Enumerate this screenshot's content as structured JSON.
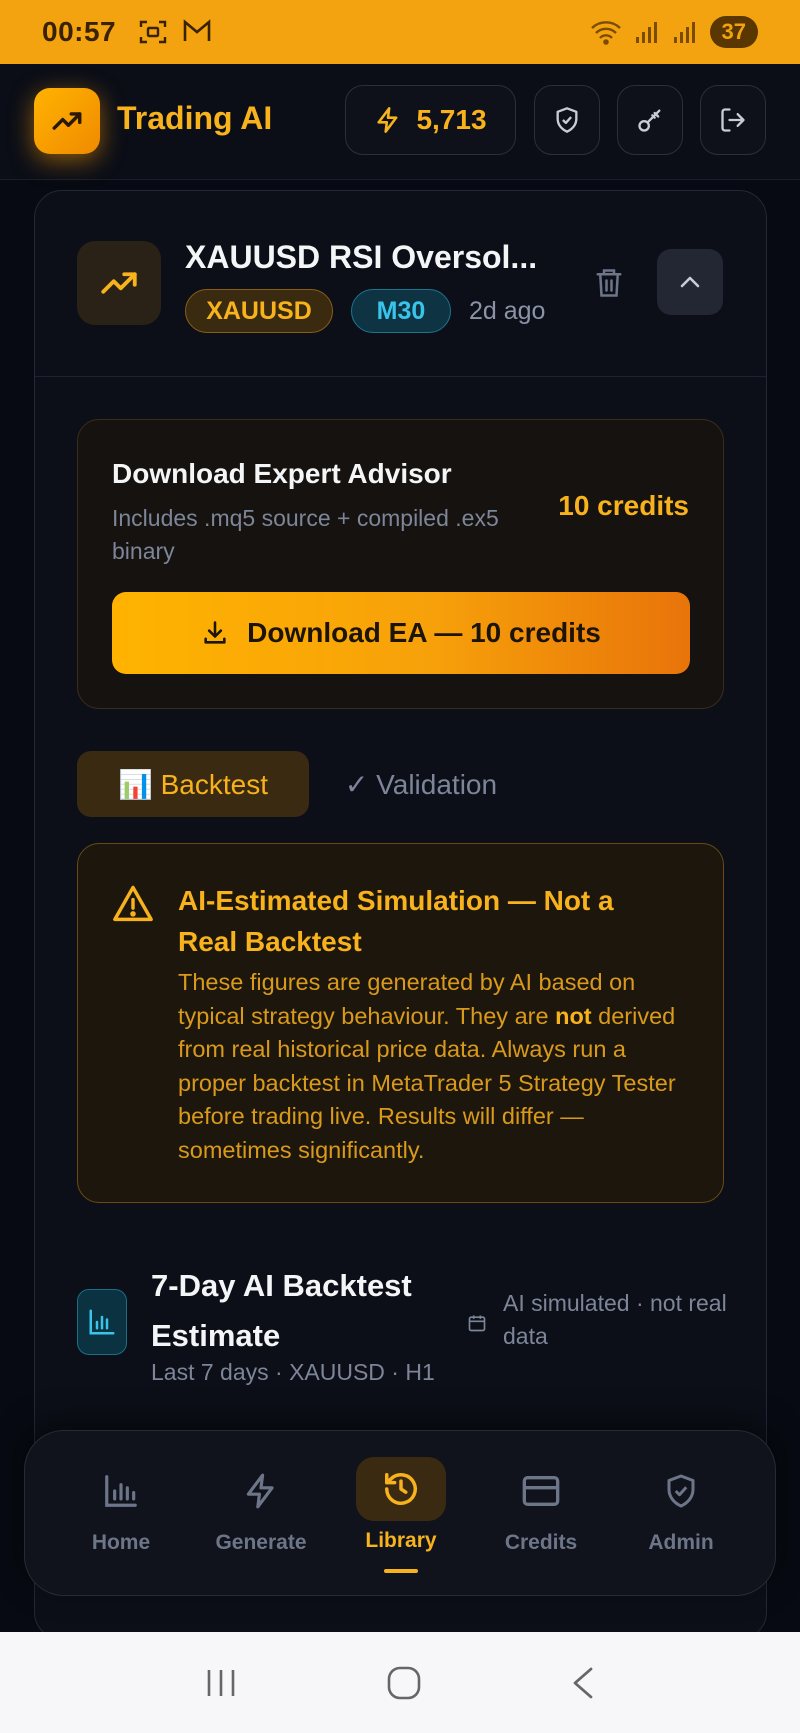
{
  "status_bar": {
    "time": "00:57",
    "battery": "37"
  },
  "header": {
    "title": "Trading AI",
    "credits": "5,713"
  },
  "strategy": {
    "title": "XAUUSD RSI Oversol...",
    "symbol": "XAUUSD",
    "timeframe": "M30",
    "age": "2d ago"
  },
  "download": {
    "title": "Download Expert Advisor",
    "subtitle": "Includes .mq5 source + compiled .ex5 binary",
    "cost": "10 credits",
    "button_label": "Download EA — 10 credits"
  },
  "tabs": [
    {
      "label": "📊 Backtest",
      "active": true
    },
    {
      "label": "✓ Validation",
      "active": false
    }
  ],
  "warning": {
    "title": "AI-Estimated Simulation — Not a Real Backtest",
    "body_before": "These figures are generated by AI based on typical strategy behaviour. They are ",
    "body_bold": "not",
    "body_after": " derived from real historical price data. Always run a proper backtest in MetaTrader 5 Strategy Tester before trading live. Results will differ — sometimes significantly."
  },
  "backtest": {
    "title": "7-Day AI Backtest Estimate",
    "subtitle": "Last 7 days · XAUUSD · H1",
    "note": "AI simulated · not real data"
  },
  "bottom_nav": [
    {
      "label": "Home",
      "icon": "bar-chart-icon",
      "active": false
    },
    {
      "label": "Generate",
      "icon": "lightning-icon",
      "active": false
    },
    {
      "label": "Library",
      "icon": "history-icon",
      "active": true
    },
    {
      "label": "Credits",
      "icon": "credit-card-icon",
      "active": false
    },
    {
      "label": "Admin",
      "icon": "shield-check-icon",
      "active": false
    }
  ],
  "colors": {
    "accent": "#f7b21c",
    "background": "#070a12",
    "status_bar": "#f2a30f",
    "cyan": "#39c4ea"
  }
}
